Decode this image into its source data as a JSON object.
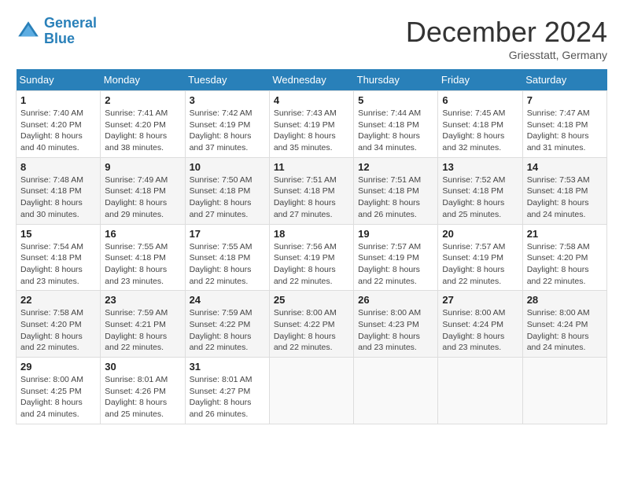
{
  "header": {
    "logo_line1": "General",
    "logo_line2": "Blue",
    "month_year": "December 2024",
    "location": "Griesstatt, Germany"
  },
  "days_of_week": [
    "Sunday",
    "Monday",
    "Tuesday",
    "Wednesday",
    "Thursday",
    "Friday",
    "Saturday"
  ],
  "weeks": [
    [
      {
        "day": 1,
        "sunrise": "Sunrise: 7:40 AM",
        "sunset": "Sunset: 4:20 PM",
        "daylight": "Daylight: 8 hours and 40 minutes."
      },
      {
        "day": 2,
        "sunrise": "Sunrise: 7:41 AM",
        "sunset": "Sunset: 4:20 PM",
        "daylight": "Daylight: 8 hours and 38 minutes."
      },
      {
        "day": 3,
        "sunrise": "Sunrise: 7:42 AM",
        "sunset": "Sunset: 4:19 PM",
        "daylight": "Daylight: 8 hours and 37 minutes."
      },
      {
        "day": 4,
        "sunrise": "Sunrise: 7:43 AM",
        "sunset": "Sunset: 4:19 PM",
        "daylight": "Daylight: 8 hours and 35 minutes."
      },
      {
        "day": 5,
        "sunrise": "Sunrise: 7:44 AM",
        "sunset": "Sunset: 4:18 PM",
        "daylight": "Daylight: 8 hours and 34 minutes."
      },
      {
        "day": 6,
        "sunrise": "Sunrise: 7:45 AM",
        "sunset": "Sunset: 4:18 PM",
        "daylight": "Daylight: 8 hours and 32 minutes."
      },
      {
        "day": 7,
        "sunrise": "Sunrise: 7:47 AM",
        "sunset": "Sunset: 4:18 PM",
        "daylight": "Daylight: 8 hours and 31 minutes."
      }
    ],
    [
      {
        "day": 8,
        "sunrise": "Sunrise: 7:48 AM",
        "sunset": "Sunset: 4:18 PM",
        "daylight": "Daylight: 8 hours and 30 minutes."
      },
      {
        "day": 9,
        "sunrise": "Sunrise: 7:49 AM",
        "sunset": "Sunset: 4:18 PM",
        "daylight": "Daylight: 8 hours and 29 minutes."
      },
      {
        "day": 10,
        "sunrise": "Sunrise: 7:50 AM",
        "sunset": "Sunset: 4:18 PM",
        "daylight": "Daylight: 8 hours and 27 minutes."
      },
      {
        "day": 11,
        "sunrise": "Sunrise: 7:51 AM",
        "sunset": "Sunset: 4:18 PM",
        "daylight": "Daylight: 8 hours and 27 minutes."
      },
      {
        "day": 12,
        "sunrise": "Sunrise: 7:51 AM",
        "sunset": "Sunset: 4:18 PM",
        "daylight": "Daylight: 8 hours and 26 minutes."
      },
      {
        "day": 13,
        "sunrise": "Sunrise: 7:52 AM",
        "sunset": "Sunset: 4:18 PM",
        "daylight": "Daylight: 8 hours and 25 minutes."
      },
      {
        "day": 14,
        "sunrise": "Sunrise: 7:53 AM",
        "sunset": "Sunset: 4:18 PM",
        "daylight": "Daylight: 8 hours and 24 minutes."
      }
    ],
    [
      {
        "day": 15,
        "sunrise": "Sunrise: 7:54 AM",
        "sunset": "Sunset: 4:18 PM",
        "daylight": "Daylight: 8 hours and 23 minutes."
      },
      {
        "day": 16,
        "sunrise": "Sunrise: 7:55 AM",
        "sunset": "Sunset: 4:18 PM",
        "daylight": "Daylight: 8 hours and 23 minutes."
      },
      {
        "day": 17,
        "sunrise": "Sunrise: 7:55 AM",
        "sunset": "Sunset: 4:18 PM",
        "daylight": "Daylight: 8 hours and 22 minutes."
      },
      {
        "day": 18,
        "sunrise": "Sunrise: 7:56 AM",
        "sunset": "Sunset: 4:19 PM",
        "daylight": "Daylight: 8 hours and 22 minutes."
      },
      {
        "day": 19,
        "sunrise": "Sunrise: 7:57 AM",
        "sunset": "Sunset: 4:19 PM",
        "daylight": "Daylight: 8 hours and 22 minutes."
      },
      {
        "day": 20,
        "sunrise": "Sunrise: 7:57 AM",
        "sunset": "Sunset: 4:19 PM",
        "daylight": "Daylight: 8 hours and 22 minutes."
      },
      {
        "day": 21,
        "sunrise": "Sunrise: 7:58 AM",
        "sunset": "Sunset: 4:20 PM",
        "daylight": "Daylight: 8 hours and 22 minutes."
      }
    ],
    [
      {
        "day": 22,
        "sunrise": "Sunrise: 7:58 AM",
        "sunset": "Sunset: 4:20 PM",
        "daylight": "Daylight: 8 hours and 22 minutes."
      },
      {
        "day": 23,
        "sunrise": "Sunrise: 7:59 AM",
        "sunset": "Sunset: 4:21 PM",
        "daylight": "Daylight: 8 hours and 22 minutes."
      },
      {
        "day": 24,
        "sunrise": "Sunrise: 7:59 AM",
        "sunset": "Sunset: 4:22 PM",
        "daylight": "Daylight: 8 hours and 22 minutes."
      },
      {
        "day": 25,
        "sunrise": "Sunrise: 8:00 AM",
        "sunset": "Sunset: 4:22 PM",
        "daylight": "Daylight: 8 hours and 22 minutes."
      },
      {
        "day": 26,
        "sunrise": "Sunrise: 8:00 AM",
        "sunset": "Sunset: 4:23 PM",
        "daylight": "Daylight: 8 hours and 23 minutes."
      },
      {
        "day": 27,
        "sunrise": "Sunrise: 8:00 AM",
        "sunset": "Sunset: 4:24 PM",
        "daylight": "Daylight: 8 hours and 23 minutes."
      },
      {
        "day": 28,
        "sunrise": "Sunrise: 8:00 AM",
        "sunset": "Sunset: 4:24 PM",
        "daylight": "Daylight: 8 hours and 24 minutes."
      }
    ],
    [
      {
        "day": 29,
        "sunrise": "Sunrise: 8:00 AM",
        "sunset": "Sunset: 4:25 PM",
        "daylight": "Daylight: 8 hours and 24 minutes."
      },
      {
        "day": 30,
        "sunrise": "Sunrise: 8:01 AM",
        "sunset": "Sunset: 4:26 PM",
        "daylight": "Daylight: 8 hours and 25 minutes."
      },
      {
        "day": 31,
        "sunrise": "Sunrise: 8:01 AM",
        "sunset": "Sunset: 4:27 PM",
        "daylight": "Daylight: 8 hours and 26 minutes."
      },
      null,
      null,
      null,
      null
    ]
  ]
}
